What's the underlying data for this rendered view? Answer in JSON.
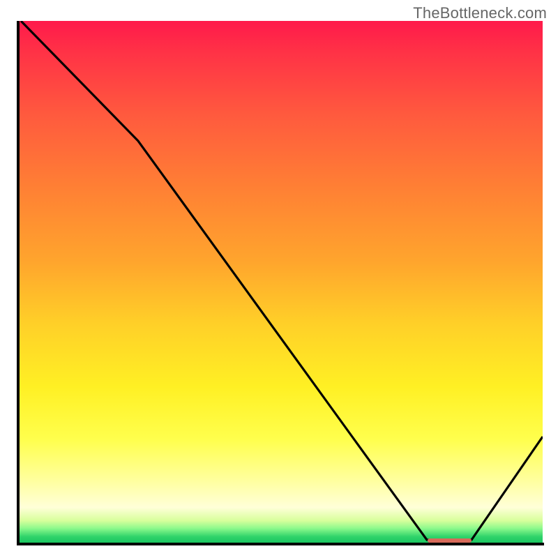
{
  "watermark": "TheBottleneck.com",
  "colors": {
    "curve": "#000000",
    "accent_bar": "#d86a5a",
    "axis": "#000000"
  },
  "chart_data": {
    "type": "line",
    "title": "",
    "xlabel": "",
    "ylabel": "",
    "xlim": [
      0,
      100
    ],
    "ylim": [
      0,
      100
    ],
    "grid": false,
    "x": [
      0,
      23,
      78,
      86,
      100
    ],
    "values": [
      100,
      77,
      0,
      0,
      20
    ],
    "accent_range_x": [
      78,
      86
    ],
    "notes": "Background is a vertical heat gradient from red (top) through orange/yellow to green (bottom). A black curve descends from top-left, kinks near x≈23, drops linearly to y=0 around x≈78, stays at 0 until x≈86 where a small red/coral bar sits on the baseline, then rises toward x=100."
  }
}
